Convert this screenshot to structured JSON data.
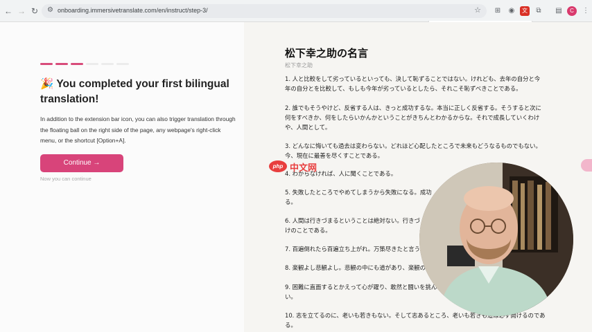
{
  "browser": {
    "url": "onboarding.immersivetranslate.com/en/instruct/step-3/",
    "avatar_initial": "C"
  },
  "left": {
    "progress": {
      "completed": 3,
      "total": 6
    },
    "title_emoji": "🎉",
    "title": "You completed your first bilingual translation!",
    "description": "In addition to the extension bar icon, you can also trigger translation through the floating ball on the right side of the page, any webpage's right-click menu, or the shortcut [Option+A].",
    "continue_label": "Continue →",
    "hint": "Now you can continue"
  },
  "right": {
    "title": "松下幸之助の名言",
    "subtitle": "松下幸之助",
    "quotes": [
      {
        "line1": "1. 人と比較をして劣っているといっても、決して恥ずることではない。けれども、去年の自分と今",
        "line2": "年の自分とを比較して、もしも今年が劣っているとしたら、それこそ恥ずべきことである。"
      },
      {
        "line1": "2. 誰でもそうやけど、反省する人は、きっと成功するな。本当に正しく反省する。そうすると次に",
        "line2": "何をすべきか、何をしたらいかんかということがきちんとわかるからな。それで成長していくわけ",
        "line3": "や、人間として。"
      },
      {
        "line1": "3. どんなに悔いても過去は変わらない。どれほど心配したところで未来もどうなるものでもない。",
        "line2": "今、現在に最善を尽くすことである。"
      },
      {
        "line1": "4. わからなければ、人に聞くことである。"
      },
      {
        "line1": "5. 失敗したところでやめてしまうから失敗になる。成功",
        "line2": "る。"
      },
      {
        "line1": "6. 人間は行きづまるということは絶対ない。行きづ",
        "line2": "けのことである。"
      },
      {
        "line1": "7. 百遍倒れたら百遍立ち上がれ。万策尽きたと言う"
      },
      {
        "line1": "8. 楽観よし悲観よし。悲観の中にも道があり、楽観の"
      },
      {
        "line1": "9. 困難に直面するとかえって心が躍り、敢然と闘いを挑ん",
        "line2": "い。"
      },
      {
        "line1": "10. 志を立てるのに、老いも若きもない。そして志あるところ、老いも若きも道は必ず開けるのであ",
        "line2": "る。"
      }
    ]
  },
  "watermark": {
    "brand": "php",
    "text": "中文网"
  },
  "colors": {
    "accent": "#d8447a",
    "progress_done": "#d84c7a",
    "progress_todo": "#ececec"
  }
}
